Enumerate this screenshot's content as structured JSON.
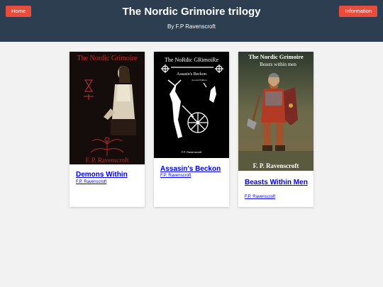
{
  "header": {
    "home_label": "Home",
    "info_label": "Information",
    "title": "The Nordic Grimoire trilogy",
    "subtitle": "By F.P Ravenscroft"
  },
  "colors": {
    "header_bg": "#2d3e50",
    "button_bg": "#e74c3c",
    "link": "#0000ee",
    "page_bg": "#f2f2f2"
  },
  "books": [
    {
      "title": "Demons Within",
      "author": "F.P. Ravenscroft",
      "cover": {
        "series": "The Nordic Grimoire",
        "author": "F. P. Ravenscroft",
        "subtitle": ""
      }
    },
    {
      "title": "Assasin's Beckon",
      "author": "F.P. Ravenscroft",
      "cover": {
        "series": "The NoRdic GRimoiRe",
        "author": "F.P. Ravenscroft",
        "subtitle": "Assasin's Beckon",
        "edition": "Second Edition"
      }
    },
    {
      "title": "Beasts Within Men",
      "author": "F.P. Ravenscroft",
      "cover": {
        "series": "The Nordic Grimoire",
        "author": "F. P. Ravenscroft",
        "subtitle": "Beasts within men"
      }
    }
  ]
}
